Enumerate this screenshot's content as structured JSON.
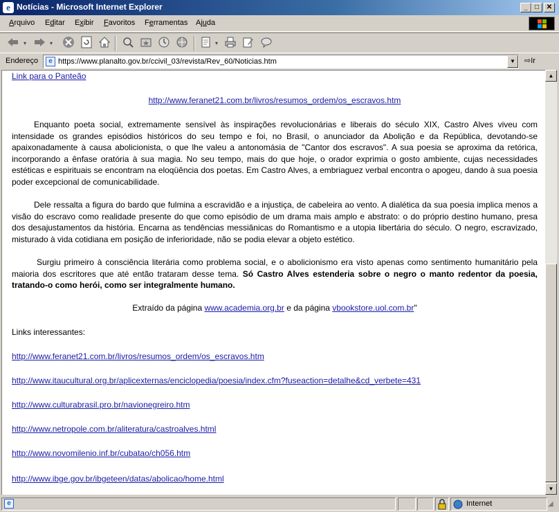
{
  "window": {
    "title": "Notícias - Microsoft Internet Explorer"
  },
  "menu": {
    "items": [
      {
        "label": "Arquivo",
        "key": "A"
      },
      {
        "label": "Editar",
        "key": "d"
      },
      {
        "label": "Exibir",
        "key": "x"
      },
      {
        "label": "Favoritos",
        "key": "F"
      },
      {
        "label": "Ferramentas",
        "key": "e"
      },
      {
        "label": "Ajuda",
        "key": "u"
      }
    ]
  },
  "toolbar": {
    "icons": [
      "back-icon",
      "forward-icon",
      "stop-icon",
      "refresh-icon",
      "home-icon",
      "search-icon",
      "favorites-icon",
      "history-icon",
      "channels-icon",
      "mail-icon",
      "print-icon",
      "edit-icon",
      "discuss-icon"
    ]
  },
  "address": {
    "label": "Endereço",
    "url": "https://www.planalto.gov.br/ccivil_03/revista/Rev_60/Noticias.htm",
    "go_label": "Ir"
  },
  "content": {
    "top_link": "Link para o Panteão",
    "source_link": "http://www.feranet21.com.br/livros/resumos_ordem/os_escravos.htm",
    "paragraph1": "Enquanto poeta social, extremamente sensível às inspirações revolucionárias e liberais do século XIX, Castro Alves viveu com intensidade os grandes episódios históricos do seu tempo e foi, no Brasil, o anunciador da Abolição e da República, devotando-se apaixonadamente à causa abolicionista, o que lhe valeu a antonomásia de \"Cantor dos escravos\". A sua poesia se aproxima da retórica, incorporando a ênfase oratória à sua magia. No seu tempo, mais do que hoje, o orador exprimia o gosto ambiente, cujas necessidades estéticas e espirituais se encontram na eloqüência dos poetas. Em Castro Alves, a embriaguez verbal encontra o apogeu, dando à sua poesia poder excepcional de comunicabilidade.",
    "paragraph2": "Dele ressalta a figura do bardo que fulmina a escravidão e a injustiça, de cabeleira ao vento. A dialética da sua poesia implica menos a visão do escravo como realidade presente do que como episódio de um drama mais amplo e abstrato: o do próprio destino humano, presa dos desajustamentos da história. Encarna as tendências messiânicas do Romantismo e a utopia libertária do século. O negro, escravizado, misturado à vida cotidiana em posição de inferioridade, não se podia elevar a objeto estético.",
    "paragraph3_normal": "Surgiu primeiro à consciência literária como problema social, e o abolicionismo era visto apenas como sentimento humanitário pela maioria dos escritores que até então trataram desse tema.",
    "paragraph3_bold": "Só Castro Alves estenderia sobre o negro o manto redentor da poesia, tratando-o como herói, como ser integralmente humano.",
    "extract_prefix": "Extraído da página",
    "extract_link1": "www.academia.org.br",
    "extract_middle": "e da página",
    "extract_link2": "vbookstore.uol.com.br",
    "extract_suffix": "\"",
    "links_heading": "Links interessantes:",
    "links": [
      "http://www.feranet21.com.br/livros/resumos_ordem/os_escravos.htm",
      "http://www.itaucultural.org.br/aplicexternas/enciclopedia/poesia/index.cfm?fuseaction=detalhe&cd_verbete=431",
      "http://www.culturabrasil.pro.br/navionegreiro.htm",
      "http://www.netropole.com.br/aliteratura/castroalves.html",
      "http://www.novomilenio.inf.br/cubatao/ch056.htm",
      "http://www.ibge.gov.br/ibgeteen/datas/abolicao/home.html"
    ]
  },
  "status": {
    "zone": "Internet"
  }
}
